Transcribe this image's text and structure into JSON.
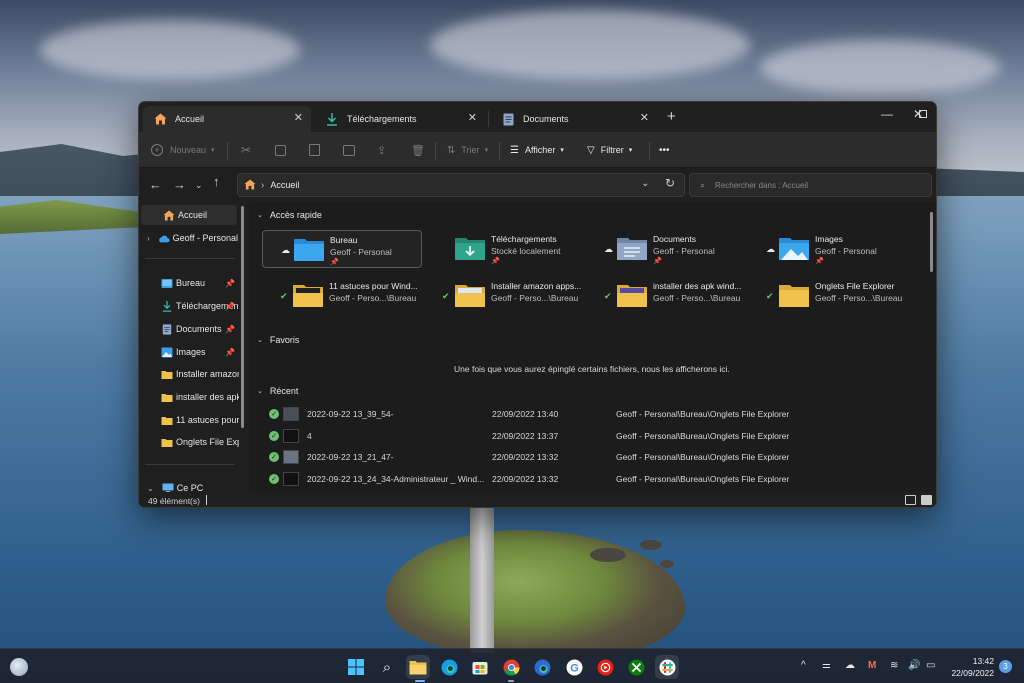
{
  "tabs": [
    {
      "label": "Accueil",
      "icon": "home-icon"
    },
    {
      "label": "Téléchargements",
      "icon": "download-icon"
    },
    {
      "label": "Documents",
      "icon": "document-icon"
    }
  ],
  "toolbar": {
    "new_label": "Nouveau",
    "sort_label": "Trier",
    "view_label": "Afficher",
    "filter_label": "Filtrer",
    "more_label": "•••"
  },
  "address": {
    "current": "Accueil",
    "search_placeholder": "Rechercher dans : Accueil"
  },
  "sidebar": {
    "items": [
      {
        "label": "Accueil",
        "icon": "home-icon"
      },
      {
        "label": "Geoff - Personal",
        "icon": "cloud-icon"
      },
      {
        "label": "Bureau",
        "icon": "desktop-folder-icon"
      },
      {
        "label": "Téléchargements",
        "icon": "download-icon"
      },
      {
        "label": "Documents",
        "icon": "document-icon"
      },
      {
        "label": "Images",
        "icon": "images-icon"
      },
      {
        "label": "Installer amazon",
        "icon": "folder-icon"
      },
      {
        "label": "installer des apk",
        "icon": "folder-icon"
      },
      {
        "label": "11 astuces pour",
        "icon": "folder-icon"
      },
      {
        "label": "Onglets File Expl",
        "icon": "folder-icon"
      },
      {
        "label": "Ce PC",
        "icon": "pc-icon"
      }
    ]
  },
  "sections": {
    "quick_access": "Accès rapide",
    "favorites": "Favoris",
    "recent": "Récent"
  },
  "quick_access": [
    {
      "name": "Bureau",
      "sub": "Geoff - Personal"
    },
    {
      "name": "Téléchargements",
      "sub": "Stocké localement"
    },
    {
      "name": "Documents",
      "sub": "Geoff - Personal"
    },
    {
      "name": "Images",
      "sub": "Geoff - Personal"
    },
    {
      "name": "11 astuces pour Wind...",
      "sub": "Geoff - Perso...\\Bureau"
    },
    {
      "name": "Installer amazon apps...",
      "sub": "Geoff - Perso...\\Bureau"
    },
    {
      "name": "installer des apk wind...",
      "sub": "Geoff - Perso...\\Bureau"
    },
    {
      "name": "Onglets File Explorer",
      "sub": "Geoff - Perso...\\Bureau"
    }
  ],
  "favorites_message": "Une fois que vous aurez épinglé certains fichiers, nous les afficherons ici.",
  "recent": [
    {
      "name": "2022-09-22 13_39_54-",
      "date": "22/09/2022 13:40",
      "location": "Geoff - Personal\\Bureau\\Onglets File Explorer"
    },
    {
      "name": "4",
      "date": "22/09/2022 13:37",
      "location": "Geoff - Personal\\Bureau\\Onglets File Explorer"
    },
    {
      "name": "2022-09-22 13_21_47-",
      "date": "22/09/2022 13:32",
      "location": "Geoff - Personal\\Bureau\\Onglets File Explorer"
    },
    {
      "name": "2022-09-22 13_24_34-Administrateur _ Wind...",
      "date": "22/09/2022 13:32",
      "location": "Geoff - Personal\\Bureau\\Onglets File Explorer"
    }
  ],
  "status": {
    "count": "49 élément(s)"
  },
  "taskbar": {
    "time": "13:42",
    "date": "22/09/2022",
    "notifications": "3"
  },
  "colors": {
    "window_bg": "#1c1c1c",
    "folder_yellow": "#f0c24b",
    "folder_blue": "#3b9fe8",
    "download_green": "#2ea58b",
    "sync_green": "#6fbf73"
  }
}
